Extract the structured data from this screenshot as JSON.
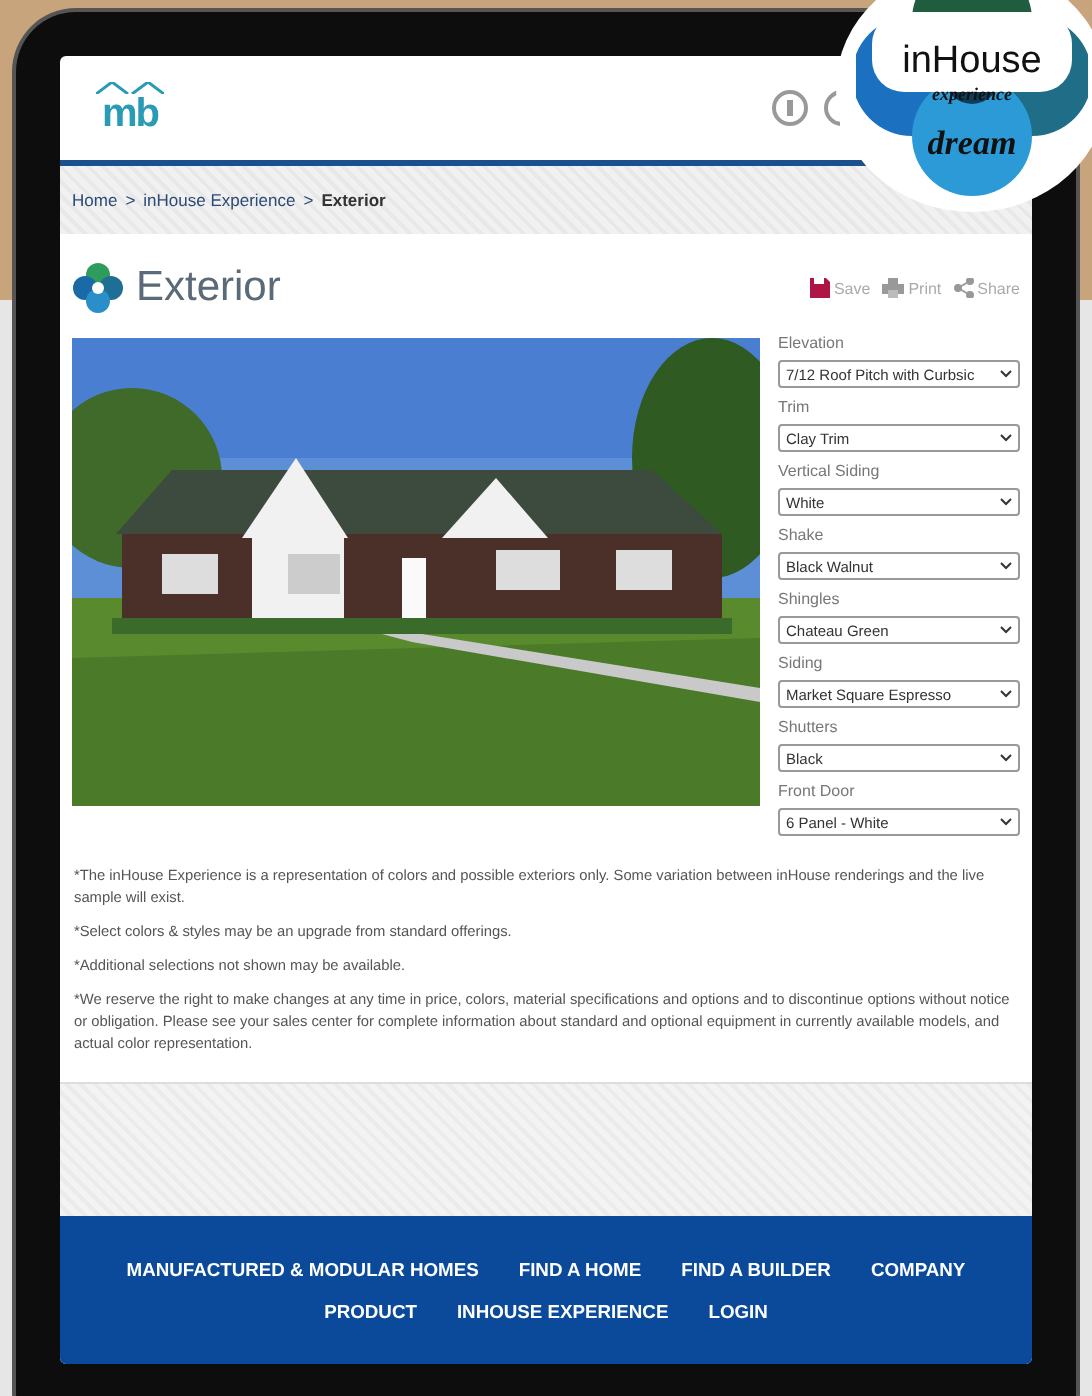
{
  "header": {
    "logo_text": "mb"
  },
  "badge": {
    "title": "inHouse",
    "subtitle": "experience",
    "tagline": "dream"
  },
  "breadcrumb": [
    "Home",
    ">",
    "inHouse Experience",
    ">",
    "Exterior"
  ],
  "page_title": "Exterior",
  "actions": [
    {
      "kind": "save",
      "label": "Save"
    },
    {
      "kind": "print",
      "label": "Print"
    },
    {
      "kind": "share",
      "label": "Share"
    }
  ],
  "options": [
    {
      "label": "Elevation",
      "value": "7/12 Roof Pitch with Curbsic"
    },
    {
      "label": "Trim",
      "value": "Clay Trim"
    },
    {
      "label": "Vertical Siding",
      "value": "White"
    },
    {
      "label": "Shake",
      "value": "Black Walnut"
    },
    {
      "label": "Shingles",
      "value": "Chateau Green"
    },
    {
      "label": "Siding",
      "value": "Market Square Espresso"
    },
    {
      "label": "Shutters",
      "value": "Black"
    },
    {
      "label": "Front Door",
      "value": "6 Panel - White"
    }
  ],
  "disclaimers": [
    "*The inHouse Experience is a representation of colors and possible exteriors only. Some variation between inHouse renderings and the live sample will exist.",
    "*Select colors & styles may be an upgrade from standard offerings.",
    "*Additional selections not shown may be available.",
    "*We reserve the right to make changes at any time in price, colors, material specifications and options and to discontinue options without notice or obligation. Please see your sales center for complete information about standard and optional equipment in currently available models, and actual color representation."
  ],
  "footer_links": [
    "MANUFACTURED & MODULAR HOMES",
    "FIND A HOME",
    "FIND A BUILDER",
    "COMPANY",
    "PRODUCT",
    "INHOUSE EXPERIENCE",
    "LOGIN"
  ]
}
